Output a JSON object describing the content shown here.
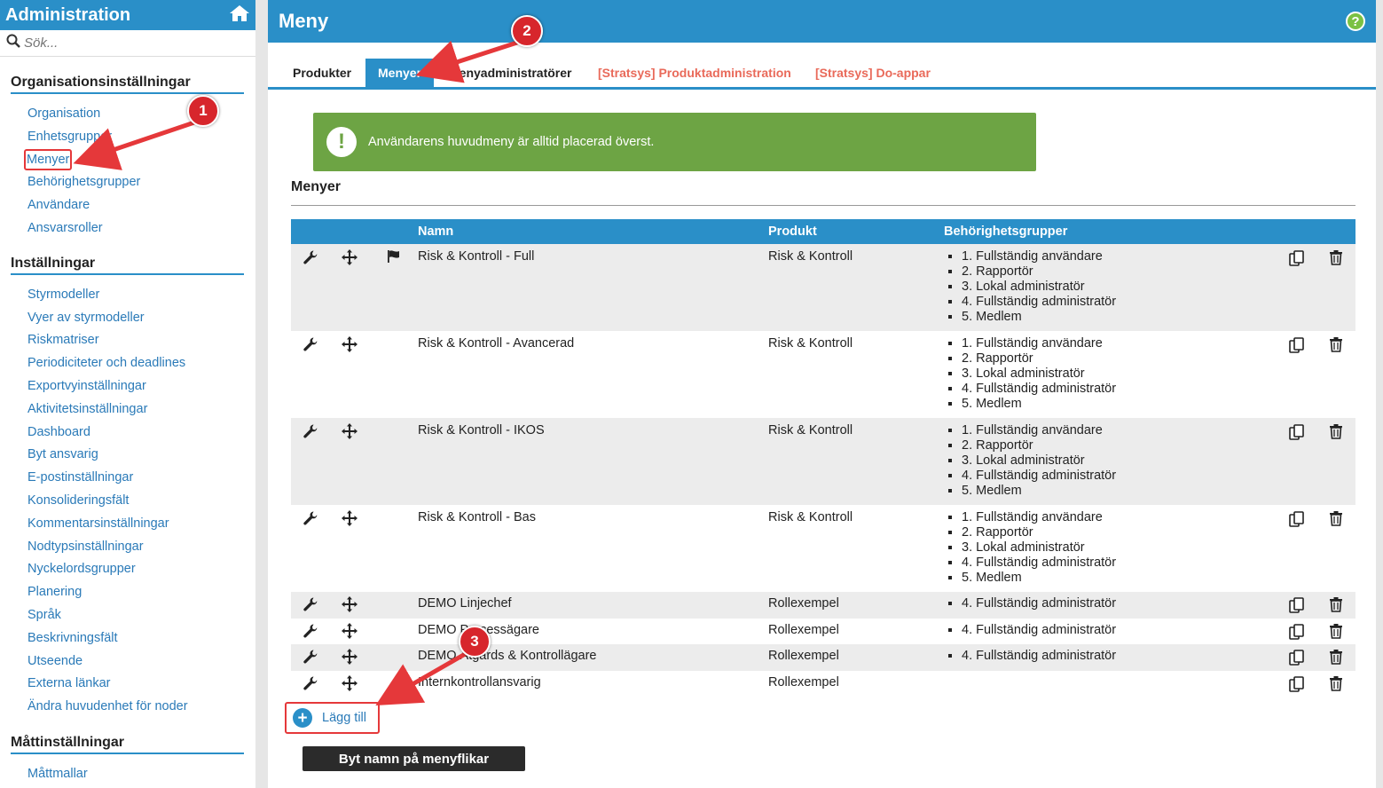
{
  "sidebar": {
    "title": "Administration",
    "search_placeholder": "Sök...",
    "sections": [
      {
        "title": "Organisationsinställningar",
        "items": [
          "Organisation",
          "Enhetsgrupper",
          "Menyer",
          "Behörighetsgrupper",
          "Användare",
          "Ansvarsroller"
        ]
      },
      {
        "title": "Inställningar",
        "items": [
          "Styrmodeller",
          "Vyer av styrmodeller",
          "Riskmatriser",
          "Periodiciteter och deadlines",
          "Exportvyinställningar",
          "Aktivitetsinställningar",
          "Dashboard",
          "Byt ansvarig",
          "E-postinställningar",
          "Konsolideringsfält",
          "Kommentarsinställningar",
          "Nodtypsinställningar",
          "Nyckelordsgrupper",
          "Planering",
          "Språk",
          "Beskrivningsfält",
          "Utseende",
          "Externa länkar",
          "Ändra huvudenhet för noder"
        ]
      },
      {
        "title": "Måttinställningar",
        "items": [
          "Måttmallar"
        ]
      }
    ]
  },
  "main": {
    "title": "Meny",
    "tabs": [
      "Produkter",
      "Menyer",
      "Menyadministratörer",
      "[Stratsys] Produktadministration",
      "[Stratsys] Do-appar"
    ],
    "alert_text": "Användarens huvudmeny är alltid placerad överst.",
    "list_title": "Menyer",
    "table": {
      "headers": [
        "Namn",
        "Produkt",
        "Behörighetsgrupper"
      ],
      "rows": [
        {
          "name": "Risk & Kontroll - Full",
          "product": "Risk & Kontroll",
          "groups": [
            "1. Fullständig användare",
            "2. Rapportör",
            "3. Lokal administratör",
            "4. Fullständig administratör",
            "5. Medlem"
          ]
        },
        {
          "name": "Risk & Kontroll - Avancerad",
          "product": "Risk & Kontroll",
          "groups": [
            "1. Fullständig användare",
            "2. Rapportör",
            "3. Lokal administratör",
            "4. Fullständig administratör",
            "5. Medlem"
          ]
        },
        {
          "name": "Risk & Kontroll - IKOS",
          "product": "Risk & Kontroll",
          "groups": [
            "1. Fullständig användare",
            "2. Rapportör",
            "3. Lokal administratör",
            "4. Fullständig administratör",
            "5. Medlem"
          ]
        },
        {
          "name": "Risk & Kontroll - Bas",
          "product": "Risk & Kontroll",
          "groups": [
            "1. Fullständig användare",
            "2. Rapportör",
            "3. Lokal administratör",
            "4. Fullständig administratör",
            "5. Medlem"
          ]
        },
        {
          "name": "DEMO Linjechef",
          "product": "Rollexempel",
          "groups": [
            "4. Fullständig administratör"
          ]
        },
        {
          "name": "DEMO Processägare",
          "product": "Rollexempel",
          "groups": [
            "4. Fullständig administratör"
          ]
        },
        {
          "name": "DEMO Åtgärds & Kontrollägare",
          "product": "Rollexempel",
          "groups": [
            "4. Fullständig administratör"
          ]
        },
        {
          "name": "Internkontrollansvarig",
          "product": "Rollexempel",
          "groups": []
        }
      ]
    },
    "add_label": "Lägg till",
    "rename_label": "Byt namn på menyflikar"
  },
  "annotations": [
    "1",
    "2",
    "3"
  ],
  "colors": {
    "accent": "#2a8fc8",
    "alert": "#6da444",
    "annotation": "#d7262c",
    "external_tab": "#e96a5a"
  }
}
